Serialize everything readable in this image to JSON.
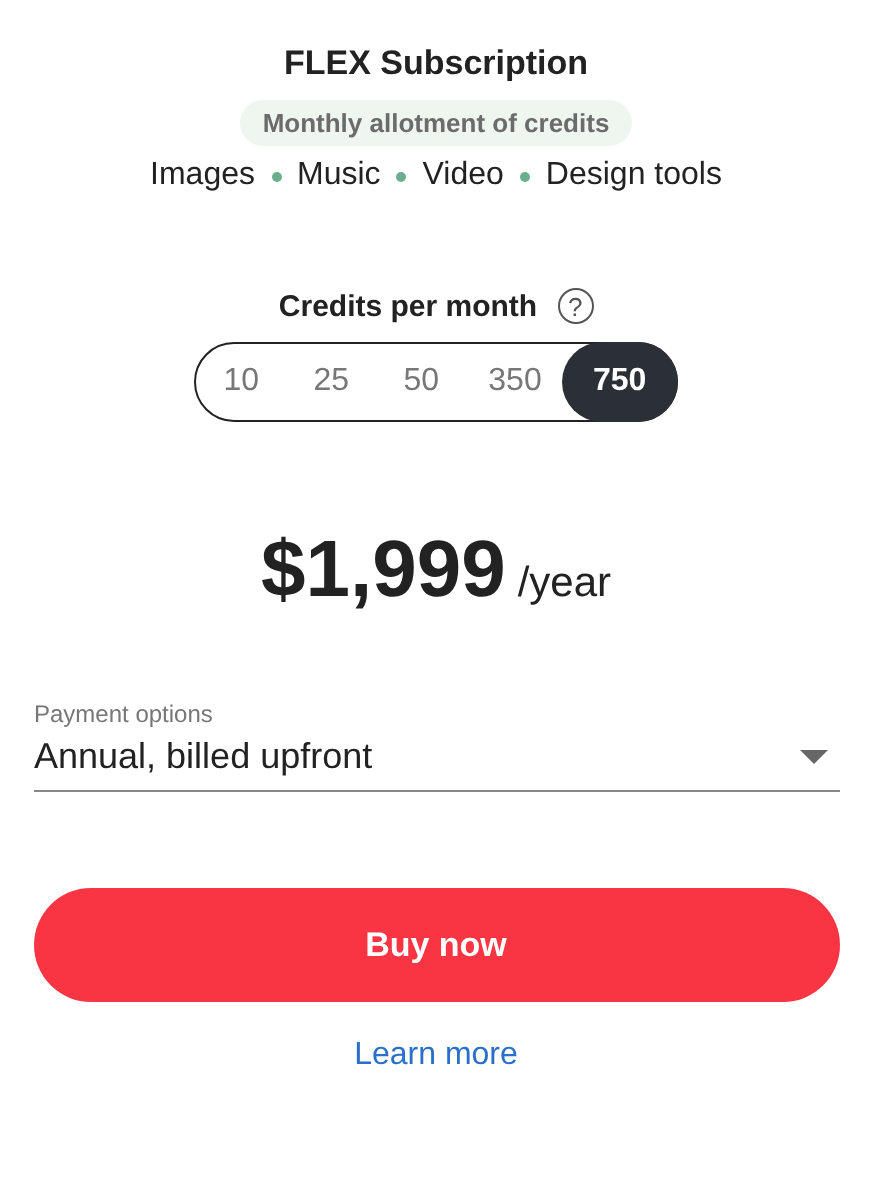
{
  "title": "FLEX Subscription",
  "subtitle": "Monthly allotment of credits",
  "features": [
    "Images",
    "Music",
    "Video",
    "Design tools"
  ],
  "credits": {
    "label": "Credits per month",
    "help": "?",
    "options": [
      {
        "label": "10",
        "selected": false
      },
      {
        "label": "25",
        "selected": false
      },
      {
        "label": "50",
        "selected": false
      },
      {
        "label": "350",
        "selected": false
      },
      {
        "label": "750",
        "selected": true
      }
    ]
  },
  "price": {
    "amount": "$1,999",
    "period": "/year"
  },
  "payment": {
    "label": "Payment options",
    "value": "Annual, billed upfront"
  },
  "buy_button": "Buy now",
  "learn_more": "Learn more"
}
